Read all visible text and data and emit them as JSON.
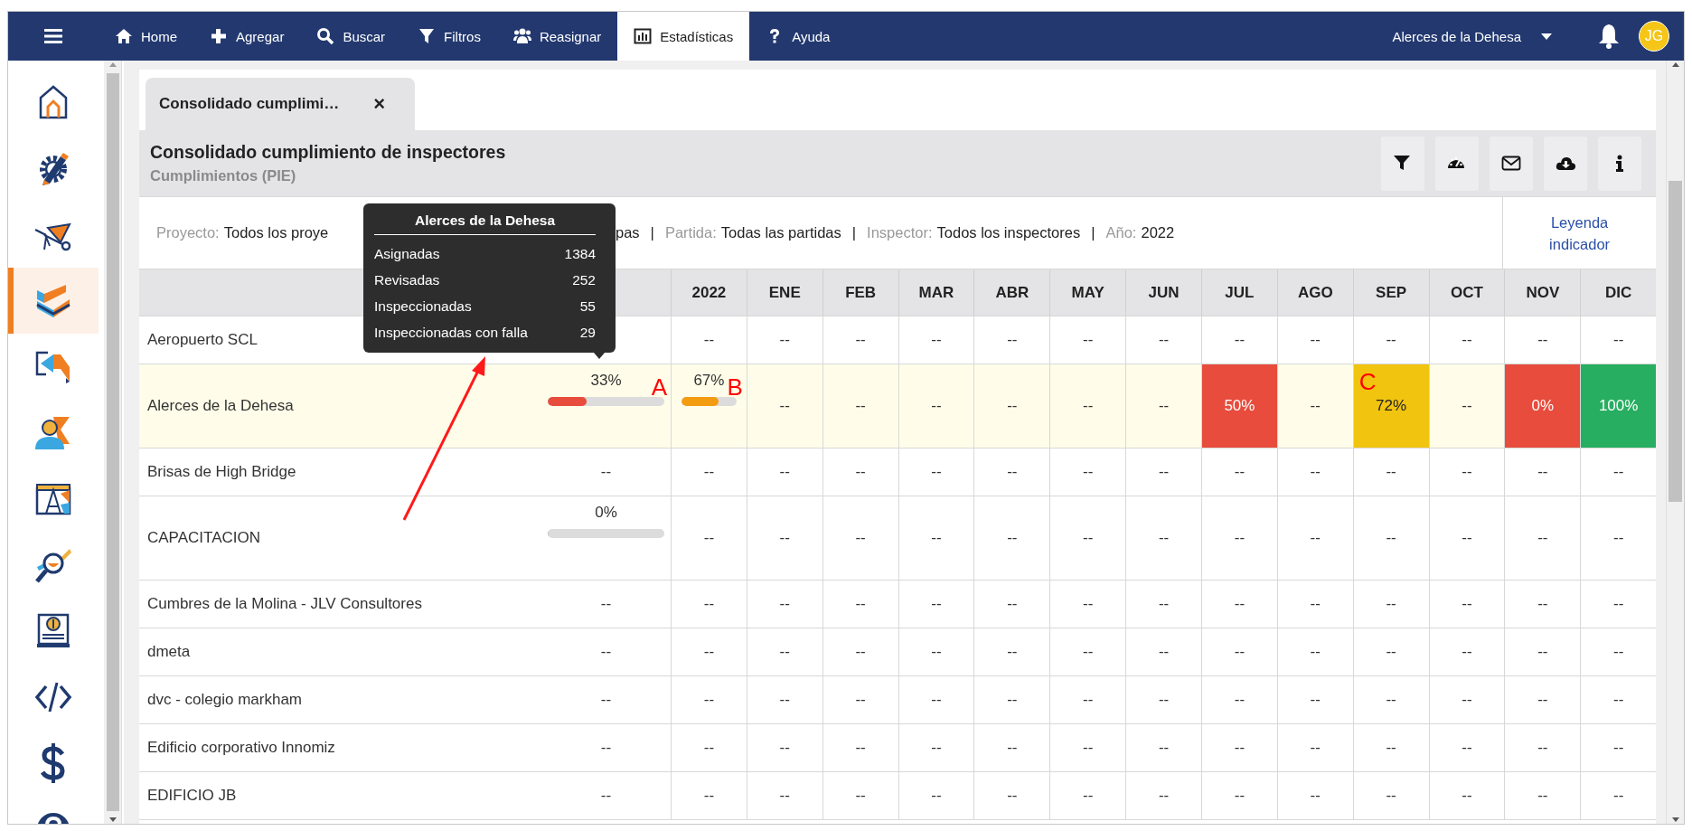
{
  "navbar": {
    "items": [
      {
        "label": "Home",
        "selected": false
      },
      {
        "label": "Agregar",
        "selected": false
      },
      {
        "label": "Buscar",
        "selected": false
      },
      {
        "label": "Filtros",
        "selected": false
      },
      {
        "label": "Reasignar",
        "selected": false
      },
      {
        "label": "Estadísticas",
        "selected": true
      },
      {
        "label": "Ayuda",
        "selected": false
      }
    ],
    "project_selector": "Alerces de la Dehesa",
    "avatar": "JG"
  },
  "sidebar": {
    "items": [
      {
        "selected": false
      },
      {
        "selected": false
      },
      {
        "selected": false
      },
      {
        "selected": true
      },
      {
        "selected": false
      },
      {
        "selected": false
      },
      {
        "selected": false
      },
      {
        "selected": false
      },
      {
        "selected": false
      },
      {
        "selected": false
      },
      {
        "selected": false
      },
      {
        "selected": false
      }
    ]
  },
  "tab": {
    "label": "Consolidado cumplimi…",
    "close": "×"
  },
  "report": {
    "title": "Consolidado cumplimiento de inspectores",
    "subtitle": "Cumplimientos (PIE)"
  },
  "filters": [
    {
      "kind": "label",
      "text": "Proyecto:"
    },
    {
      "kind": "value",
      "text": "Todos los proye"
    },
    {
      "kind": "value",
      "text": "pas"
    },
    {
      "kind": "separator",
      "text": "|"
    },
    {
      "kind": "label",
      "text": "Partida:"
    },
    {
      "kind": "value",
      "text": "Todas las partidas"
    },
    {
      "kind": "separator",
      "text": "|"
    },
    {
      "kind": "label",
      "text": "Inspector:"
    },
    {
      "kind": "value",
      "text": "Todos los inspectores"
    },
    {
      "kind": "separator",
      "text": "|"
    },
    {
      "kind": "label",
      "text": "Año:"
    },
    {
      "kind": "value",
      "text": "2022"
    }
  ],
  "legend_link": "Leyenda indicador",
  "table": {
    "columns": [
      "",
      "2022",
      "ENE",
      "FEB",
      "MAR",
      "ABR",
      "MAY",
      "JUN",
      "JUL",
      "AGO",
      "SEP",
      "OCT",
      "NOV",
      "DIC"
    ],
    "rows": [
      {
        "name": "Aeropuerto SCL",
        "highlighted": false,
        "cells": [
          {
            "kind": "blank"
          },
          {
            "kind": "text",
            "text": "--"
          },
          {
            "kind": "text",
            "text": "--"
          },
          {
            "kind": "text",
            "text": "--"
          },
          {
            "kind": "text",
            "text": "--"
          },
          {
            "kind": "text",
            "text": "--"
          },
          {
            "kind": "text",
            "text": "--"
          },
          {
            "kind": "text",
            "text": "--"
          },
          {
            "kind": "text",
            "text": "--"
          },
          {
            "kind": "text",
            "text": "--"
          },
          {
            "kind": "text",
            "text": "--"
          },
          {
            "kind": "text",
            "text": "--"
          },
          {
            "kind": "text",
            "text": "--"
          },
          {
            "kind": "text",
            "text": "--"
          }
        ]
      },
      {
        "name": "Alerces de la Dehesa",
        "highlighted": true,
        "cells": [
          {
            "kind": "bar",
            "text": "33%",
            "level": 0.33,
            "color": "#e74c3c",
            "annotation": "A"
          },
          {
            "kind": "bar",
            "text": "67%",
            "level": 0.67,
            "color": "#f39c12",
            "annotation": "B"
          },
          {
            "kind": "text",
            "text": "--"
          },
          {
            "kind": "text",
            "text": "--"
          },
          {
            "kind": "text",
            "text": "--"
          },
          {
            "kind": "text",
            "text": "--"
          },
          {
            "kind": "text",
            "text": "--"
          },
          {
            "kind": "text",
            "text": "--"
          },
          {
            "kind": "fill",
            "text": "50%",
            "color": "#e74c3c"
          },
          {
            "kind": "text",
            "text": "--"
          },
          {
            "kind": "fill",
            "text": "72%",
            "color": "#f1c40f",
            "annotation": "C"
          },
          {
            "kind": "text",
            "text": "--"
          },
          {
            "kind": "fill",
            "text": "0%",
            "color": "#e74c3c"
          },
          {
            "kind": "fill",
            "text": "100%",
            "color": "#27ae60"
          }
        ]
      },
      {
        "name": "Brisas de High Bridge",
        "highlighted": false,
        "cells": [
          {
            "kind": "text",
            "text": "--"
          },
          {
            "kind": "text",
            "text": "--"
          },
          {
            "kind": "text",
            "text": "--"
          },
          {
            "kind": "text",
            "text": "--"
          },
          {
            "kind": "text",
            "text": "--"
          },
          {
            "kind": "text",
            "text": "--"
          },
          {
            "kind": "text",
            "text": "--"
          },
          {
            "kind": "text",
            "text": "--"
          },
          {
            "kind": "text",
            "text": "--"
          },
          {
            "kind": "text",
            "text": "--"
          },
          {
            "kind": "text",
            "text": "--"
          },
          {
            "kind": "text",
            "text": "--"
          },
          {
            "kind": "text",
            "text": "--"
          },
          {
            "kind": "text",
            "text": "--"
          }
        ]
      },
      {
        "name": "CAPACITACION",
        "highlighted": false,
        "cells": [
          {
            "kind": "bar",
            "text": "0%",
            "level": 0
          },
          {
            "kind": "text",
            "text": "--"
          },
          {
            "kind": "text",
            "text": "--"
          },
          {
            "kind": "text",
            "text": "--"
          },
          {
            "kind": "text",
            "text": "--"
          },
          {
            "kind": "text",
            "text": "--"
          },
          {
            "kind": "text",
            "text": "--"
          },
          {
            "kind": "text",
            "text": "--"
          },
          {
            "kind": "text",
            "text": "--"
          },
          {
            "kind": "text",
            "text": "--"
          },
          {
            "kind": "text",
            "text": "--"
          },
          {
            "kind": "text",
            "text": "--"
          },
          {
            "kind": "text",
            "text": "--"
          },
          {
            "kind": "text",
            "text": "--"
          }
        ]
      },
      {
        "name": "Cumbres de la Molina - JLV Consultores",
        "highlighted": false,
        "cells": [
          {
            "kind": "text",
            "text": "--"
          },
          {
            "kind": "text",
            "text": "--"
          },
          {
            "kind": "text",
            "text": "--"
          },
          {
            "kind": "text",
            "text": "--"
          },
          {
            "kind": "text",
            "text": "--"
          },
          {
            "kind": "text",
            "text": "--"
          },
          {
            "kind": "text",
            "text": "--"
          },
          {
            "kind": "text",
            "text": "--"
          },
          {
            "kind": "text",
            "text": "--"
          },
          {
            "kind": "text",
            "text": "--"
          },
          {
            "kind": "text",
            "text": "--"
          },
          {
            "kind": "text",
            "text": "--"
          },
          {
            "kind": "text",
            "text": "--"
          },
          {
            "kind": "text",
            "text": "--"
          }
        ]
      },
      {
        "name": "dmeta",
        "highlighted": false,
        "cells": [
          {
            "kind": "text",
            "text": "--"
          },
          {
            "kind": "text",
            "text": "--"
          },
          {
            "kind": "text",
            "text": "--"
          },
          {
            "kind": "text",
            "text": "--"
          },
          {
            "kind": "text",
            "text": "--"
          },
          {
            "kind": "text",
            "text": "--"
          },
          {
            "kind": "text",
            "text": "--"
          },
          {
            "kind": "text",
            "text": "--"
          },
          {
            "kind": "text",
            "text": "--"
          },
          {
            "kind": "text",
            "text": "--"
          },
          {
            "kind": "text",
            "text": "--"
          },
          {
            "kind": "text",
            "text": "--"
          },
          {
            "kind": "text",
            "text": "--"
          },
          {
            "kind": "text",
            "text": "--"
          }
        ]
      },
      {
        "name": "dvc - colegio markham",
        "highlighted": false,
        "cells": [
          {
            "kind": "text",
            "text": "--"
          },
          {
            "kind": "text",
            "text": "--"
          },
          {
            "kind": "text",
            "text": "--"
          },
          {
            "kind": "text",
            "text": "--"
          },
          {
            "kind": "text",
            "text": "--"
          },
          {
            "kind": "text",
            "text": "--"
          },
          {
            "kind": "text",
            "text": "--"
          },
          {
            "kind": "text",
            "text": "--"
          },
          {
            "kind": "text",
            "text": "--"
          },
          {
            "kind": "text",
            "text": "--"
          },
          {
            "kind": "text",
            "text": "--"
          },
          {
            "kind": "text",
            "text": "--"
          },
          {
            "kind": "text",
            "text": "--"
          },
          {
            "kind": "text",
            "text": "--"
          }
        ]
      },
      {
        "name": "Edificio corporativo Innomiz",
        "highlighted": false,
        "cells": [
          {
            "kind": "text",
            "text": "--"
          },
          {
            "kind": "text",
            "text": "--"
          },
          {
            "kind": "text",
            "text": "--"
          },
          {
            "kind": "text",
            "text": "--"
          },
          {
            "kind": "text",
            "text": "--"
          },
          {
            "kind": "text",
            "text": "--"
          },
          {
            "kind": "text",
            "text": "--"
          },
          {
            "kind": "text",
            "text": "--"
          },
          {
            "kind": "text",
            "text": "--"
          },
          {
            "kind": "text",
            "text": "--"
          },
          {
            "kind": "text",
            "text": "--"
          },
          {
            "kind": "text",
            "text": "--"
          },
          {
            "kind": "text",
            "text": "--"
          },
          {
            "kind": "text",
            "text": "--"
          }
        ]
      },
      {
        "name": "EDIFICIO JB",
        "highlighted": false,
        "cells": [
          {
            "kind": "text",
            "text": "--"
          },
          {
            "kind": "text",
            "text": "--"
          },
          {
            "kind": "text",
            "text": "--"
          },
          {
            "kind": "text",
            "text": "--"
          },
          {
            "kind": "text",
            "text": "--"
          },
          {
            "kind": "text",
            "text": "--"
          },
          {
            "kind": "text",
            "text": "--"
          },
          {
            "kind": "text",
            "text": "--"
          },
          {
            "kind": "text",
            "text": "--"
          },
          {
            "kind": "text",
            "text": "--"
          },
          {
            "kind": "text",
            "text": "--"
          },
          {
            "kind": "text",
            "text": "--"
          },
          {
            "kind": "text",
            "text": "--"
          },
          {
            "kind": "text",
            "text": "--"
          }
        ]
      }
    ]
  },
  "tooltip": {
    "title": "Alerces de la Dehesa",
    "rows": [
      {
        "label": "Asignadas",
        "value": "1384"
      },
      {
        "label": "Revisadas",
        "value": "252"
      },
      {
        "label": "Inspeccionadas",
        "value": "55"
      },
      {
        "label": "Inspeccionadas con falla",
        "value": "29"
      }
    ]
  }
}
